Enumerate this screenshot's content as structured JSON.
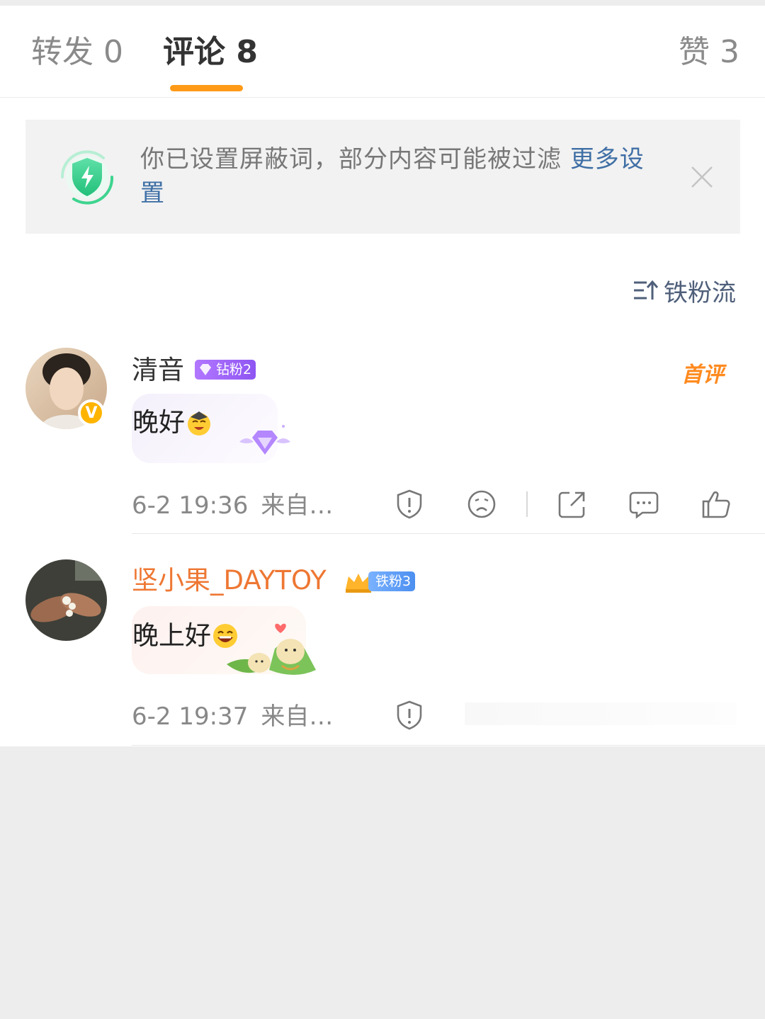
{
  "tabs": [
    {
      "label": "转发 0"
    },
    {
      "label": "评论 8"
    },
    {
      "label": "赞 3"
    }
  ],
  "notice": {
    "text": "你已设置屏蔽词，部分内容可能被过滤 ",
    "link": "更多设置"
  },
  "sort": {
    "label": "铁粉流"
  },
  "comments": [
    {
      "username": "清音",
      "badge": "钻粉2",
      "text": "晚好",
      "time": "6-2 19:36",
      "source": "来自…",
      "tag": "首评"
    },
    {
      "username": "坚小果_DAYTOY",
      "badge": "铁粉3",
      "text": "晚上好",
      "time": "6-2 19:37",
      "source": "来自…"
    }
  ],
  "colors": {
    "accent": "#ff9a17",
    "link": "#3f6fa5",
    "username_highlight": "#ee7733",
    "badge_purple": "#9b5cf6",
    "badge_blue": "#4c8ff0"
  },
  "icons": [
    "shield-icon",
    "close-icon",
    "sort-icon",
    "report-icon",
    "dislike-icon",
    "share-icon",
    "reply-icon",
    "like-icon"
  ]
}
